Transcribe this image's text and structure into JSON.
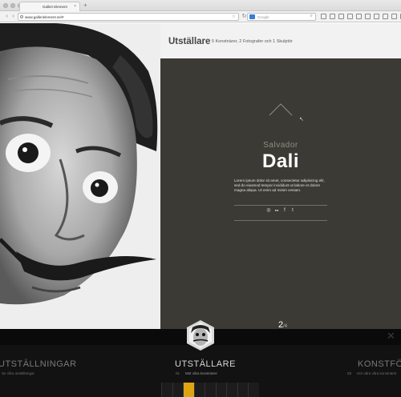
{
  "browser": {
    "tab_title": "Galleri Element",
    "url": "www.gallerielement.se/#",
    "search_placeholder": "Google",
    "search_engine_glyph": "G",
    "back_icon": "back-arrow-icon",
    "reload_icon": "reload-icon"
  },
  "header": {
    "title": "Utställare",
    "subtitle": "5 Konstnärer, 2 Fotografer och 1 Skulptör"
  },
  "artist": {
    "first_name": "Salvador",
    "last_name": "Dali",
    "bio": "Lorem ipsum dolor sit amet, consectetur adipisicing elit, sed do eiusmod tempor incididunt ut labore et dolore magna aliqua. Ut enim ad minim veniam.",
    "social_icons": [
      "instagram-icon",
      "flickr-icon",
      "facebook-icon",
      "twitter-icon"
    ],
    "social_glyphs": [
      "◎",
      "●●",
      "f",
      "t"
    ]
  },
  "pager": {
    "current": "2",
    "separator": "/",
    "total": "4"
  },
  "bottom_nav": {
    "close_glyph": "✕",
    "left": {
      "label": "UTSTÄLLNINGAR",
      "sub": "Se våra utställningar"
    },
    "center": {
      "number": "01",
      "label": "UTSTÄLLARE",
      "sub": "Möt våra konstnärer"
    },
    "right": {
      "number": "03",
      "label": "KONSTFÖR",
      "sub": "Hör våra våra konstnärer"
    },
    "thumbnails": {
      "count": 9,
      "active_index": 2
    }
  },
  "colors": {
    "panel": "#3b3a35",
    "accent": "#e0a413",
    "bottom_bar": "#121212"
  }
}
